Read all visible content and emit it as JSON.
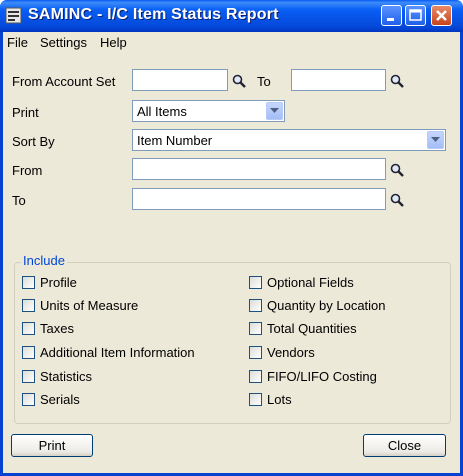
{
  "window": {
    "title": "SAMINC - I/C Item Status Report"
  },
  "menu": [
    "File",
    "Settings",
    "Help"
  ],
  "form": {
    "from_account_set_label": "From Account Set",
    "to_label": "To",
    "from_account_set_value": "",
    "to_account_set_value": "",
    "print_label": "Print",
    "print_value": "All Items",
    "sort_by_label": "Sort By",
    "sort_by_value": "Item Number",
    "from_label": "From",
    "from_value": "",
    "to2_label": "To",
    "to_value": ""
  },
  "include": {
    "title": "Include",
    "left": [
      "Profile",
      "Units of Measure",
      "Taxes",
      "Additional Item Information",
      "Statistics",
      "Serials"
    ],
    "right": [
      "Optional Fields",
      "Quantity by Location",
      "Total Quantities",
      "Vendors",
      "FIFO/LIFO Costing",
      "Lots"
    ],
    "checked": false
  },
  "buttons": {
    "print": "Print",
    "close": "Close"
  },
  "colors": {
    "titlebar": "#0a5ff5",
    "group_title": "#0046d5",
    "window_bg": "#ece9d8"
  },
  "icons": [
    "app-icon",
    "minimize-icon",
    "maximize-icon",
    "close-icon",
    "search-icon",
    "dropdown-arrow-icon"
  ]
}
